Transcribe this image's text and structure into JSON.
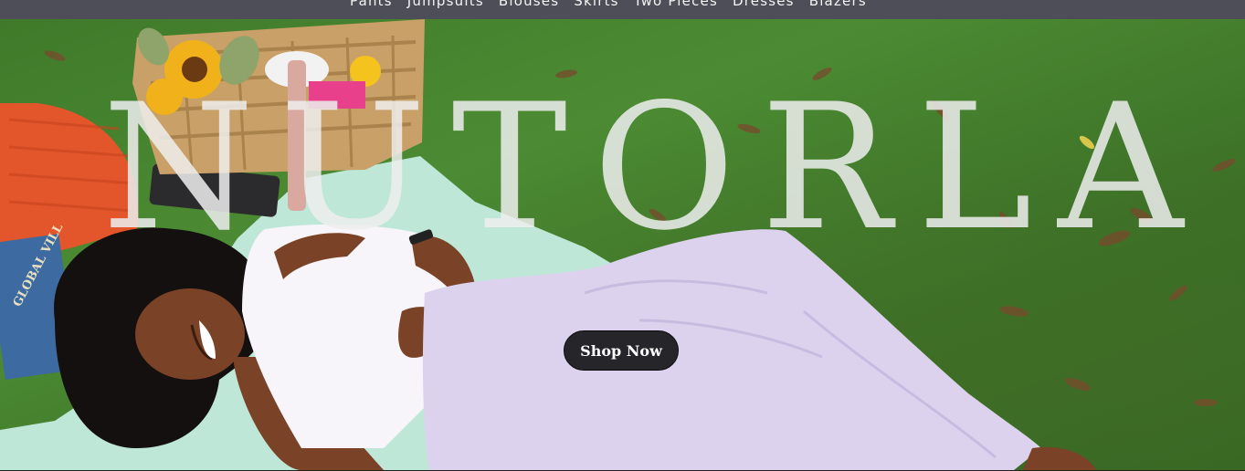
{
  "nav": {
    "items": [
      {
        "label": "Pants"
      },
      {
        "label": "Jumpsuits"
      },
      {
        "label": "Blouses"
      },
      {
        "label": "Skirts"
      },
      {
        "label": "Two Pieces"
      },
      {
        "label": "Dresses"
      },
      {
        "label": "Blazers"
      }
    ]
  },
  "hero": {
    "brand": "NUTORLA",
    "cta_label": "Shop Now",
    "book_text": "GLOBAL VILL"
  },
  "colors": {
    "nav_bg": "#4d4e57",
    "cta_bg": "#25252a",
    "grass": "#4c8b33",
    "dress": "#dcd2ee"
  }
}
